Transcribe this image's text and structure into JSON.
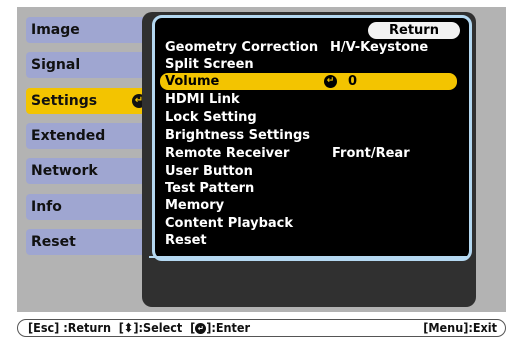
{
  "sidebar": {
    "items": [
      {
        "label": "Image"
      },
      {
        "label": "Signal"
      },
      {
        "label": "Settings"
      },
      {
        "label": "Extended"
      },
      {
        "label": "Network"
      },
      {
        "label": "Info"
      },
      {
        "label": "Reset"
      }
    ],
    "active_index": 2
  },
  "panel": {
    "return_label": "Return",
    "rows": [
      {
        "label": "Geometry Correction",
        "value": "H/V-Keystone"
      },
      {
        "label": "Split Screen",
        "value": ""
      },
      {
        "label": "Volume",
        "value": "0"
      },
      {
        "label": "HDMI Link",
        "value": ""
      },
      {
        "label": "Lock Setting",
        "value": ""
      },
      {
        "label": "Brightness Settings",
        "value": ""
      },
      {
        "label": "Remote Receiver",
        "value": "Front/Rear"
      },
      {
        "label": "User Button",
        "value": ""
      },
      {
        "label": "Test Pattern",
        "value": ""
      },
      {
        "label": "Memory",
        "value": ""
      },
      {
        "label": "Content Playback",
        "value": ""
      },
      {
        "label": "Reset",
        "value": ""
      }
    ],
    "selected_index": 2
  },
  "help_bar": {
    "esc": "[Esc] :Return",
    "select": "[⬍]:Select",
    "enter_prefix": "[",
    "enter_suffix": "]:Enter",
    "menu": "[Menu]:Exit"
  },
  "colors": {
    "accent": "#f3c400",
    "tab": "#9fa6d1",
    "frame": "#b4d8f1",
    "panel": "#303030"
  },
  "icons": {
    "enter": "enter-icon",
    "updown": "up-down-arrow-icon"
  }
}
